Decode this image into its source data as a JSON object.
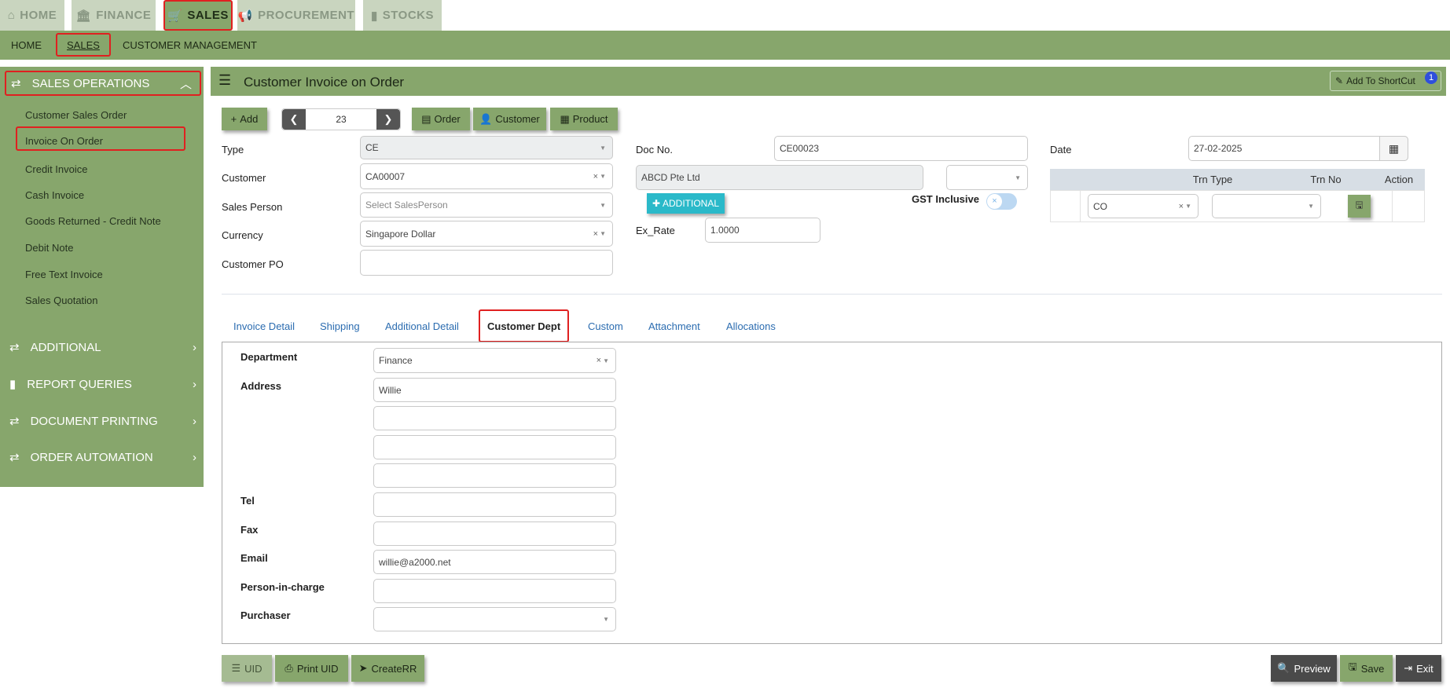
{
  "top_tabs": [
    {
      "label": "HOME",
      "icon": "home-icon"
    },
    {
      "label": "FINANCE",
      "icon": "bank-icon"
    },
    {
      "label": "SALES",
      "icon": "cart-icon"
    },
    {
      "label": "PROCUREMENT",
      "icon": "megaphone-icon"
    },
    {
      "label": "STOCKS",
      "icon": "bar-chart-icon"
    }
  ],
  "sub_nav": [
    "HOME",
    "SALES",
    "CUSTOMER MANAGEMENT"
  ],
  "sidebar": {
    "sections": [
      "SALES OPERATIONS",
      "ADDITIONAL",
      "REPORT QUERIES",
      "DOCUMENT PRINTING",
      "ORDER AUTOMATION"
    ],
    "items": [
      "Customer Sales Order",
      "Invoice On Order",
      "Credit Invoice",
      "Cash Invoice",
      "Goods Returned - Credit Note",
      "Debit Note",
      "Free Text Invoice",
      "Sales Quotation"
    ]
  },
  "header": {
    "title": "Customer Invoice on Order",
    "shortcut": "Add To ShortCut",
    "shortcut_badge": "1"
  },
  "toolbar": {
    "add": "Add",
    "record_no": "23",
    "order": "Order",
    "customer": "Customer",
    "product": "Product"
  },
  "form": {
    "type_label": "Type",
    "type_value": "CE",
    "customer_label": "Customer",
    "customer_value": "CA00007",
    "sales_person_label": "Sales Person",
    "sales_person_placeholder": "Select SalesPerson",
    "currency_label": "Currency",
    "currency_value": "Singapore Dollar",
    "customer_po_label": "Customer PO",
    "customer_po_value": "",
    "doc_no_label": "Doc No.",
    "doc_no_value": "CE00023",
    "customer_name": "ABCD Pte Ltd",
    "additional_button": "ADDITIONAL",
    "gst_label": "GST Inclusive",
    "ex_rate_label": "Ex_Rate",
    "ex_rate_value": "1.0000",
    "date_label": "Date",
    "date_value": "27-02-2025"
  },
  "trn_table": {
    "headers": [
      "Trn Type",
      "Trn No",
      "Action"
    ],
    "trn_type_value": "CO",
    "trn_no_value": ""
  },
  "tabs": [
    "Invoice Detail",
    "Shipping",
    "Additional Detail",
    "Customer Dept",
    "Custom",
    "Attachment",
    "Allocations"
  ],
  "customer_dept": {
    "department_label": "Department",
    "department_value": "Finance",
    "address_label": "Address",
    "address_lines": [
      "Willie",
      "",
      "",
      ""
    ],
    "tel_label": "Tel",
    "tel_value": "",
    "fax_label": "Fax",
    "fax_value": "",
    "email_label": "Email",
    "email_value": "willie@a2000.net",
    "pic_label": "Person-in-charge",
    "pic_value": "",
    "purchaser_label": "Purchaser",
    "purchaser_value": ""
  },
  "bottom": {
    "uid": "UID",
    "print_uid": "Print UID",
    "create_rr": "CreateRR",
    "preview": "Preview",
    "save": "Save",
    "exit": "Exit"
  },
  "colors": {
    "green": "#87a66c",
    "red_highlight": "#e02020",
    "cyan": "#2ab9c9"
  }
}
